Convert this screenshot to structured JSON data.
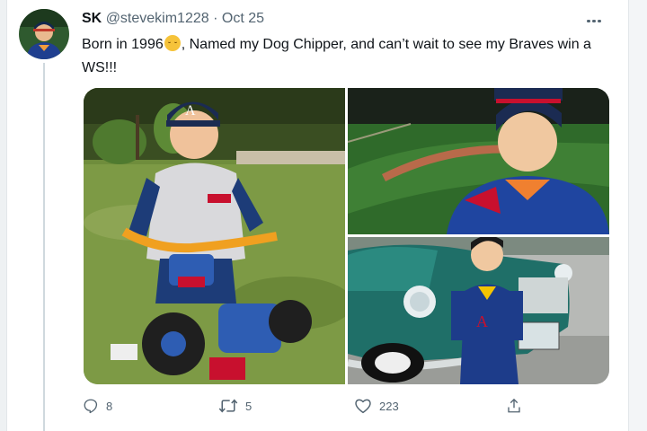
{
  "tweet": {
    "author_name": "SK",
    "handle": "@stevekim1228",
    "separator": "·",
    "date": "Oct 25",
    "text_part1": "Born in 1996",
    "text_part2": ", Named my Dog Chipper, and can’t wait to see my Braves win a WS!!!",
    "emoji": "relieved-face-emoji"
  },
  "photos": [
    {
      "name": "photo-child-on-tricycle"
    },
    {
      "name": "photo-child-at-ballpark"
    },
    {
      "name": "photo-child-with-vintage-truck"
    }
  ],
  "actions": {
    "reply_count": "8",
    "retweet_count": "5",
    "like_count": "223"
  },
  "colors": {
    "text": "#0f1419",
    "secondary": "#536471",
    "thread_line": "#cfd9de",
    "braves_navy": "#13274f",
    "braves_red": "#ce1141"
  }
}
